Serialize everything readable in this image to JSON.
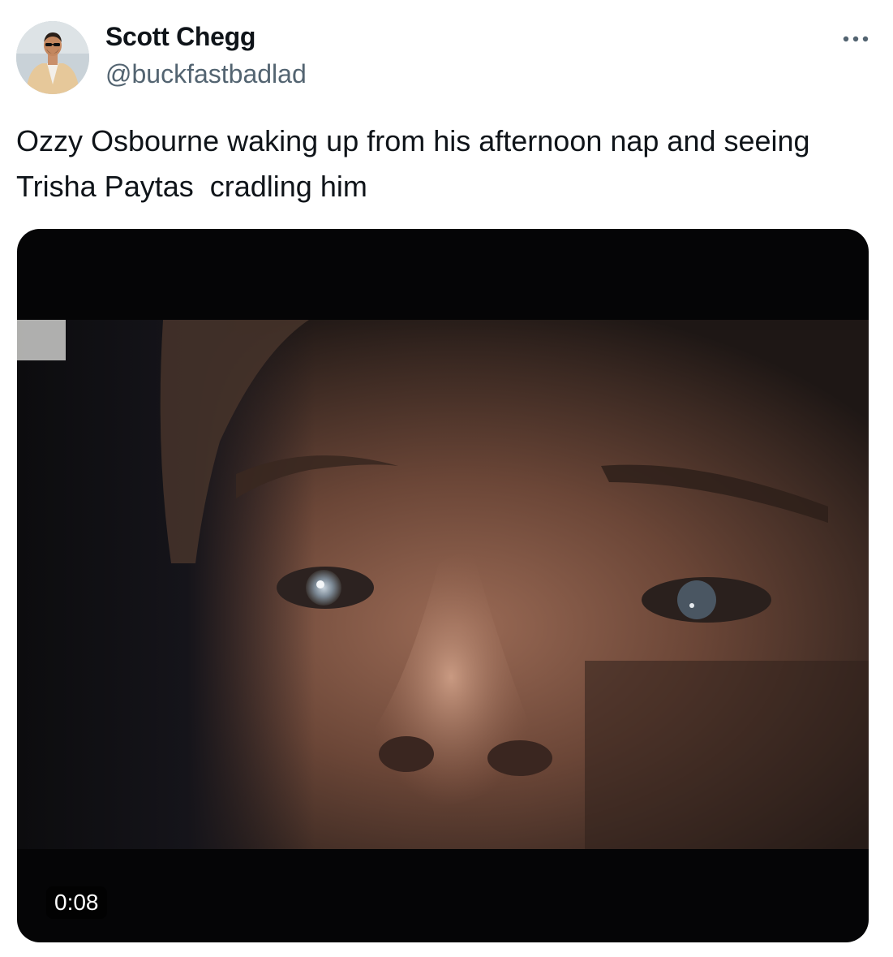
{
  "author": {
    "display_name": "Scott Chegg",
    "handle": "@buckfastbadlad",
    "avatar_icon": "profile-photo"
  },
  "more_icon": "more-options-icon",
  "tweet": {
    "text": "Ozzy Osbourne waking up from his afternoon nap and seeing\nTrisha Paytas  cradling him"
  },
  "media": {
    "type": "video",
    "duration": "0:08",
    "description_icon": "video-thumbnail"
  },
  "colors": {
    "text_primary": "#0f1419",
    "text_secondary": "#536471",
    "media_background": "#050506"
  }
}
